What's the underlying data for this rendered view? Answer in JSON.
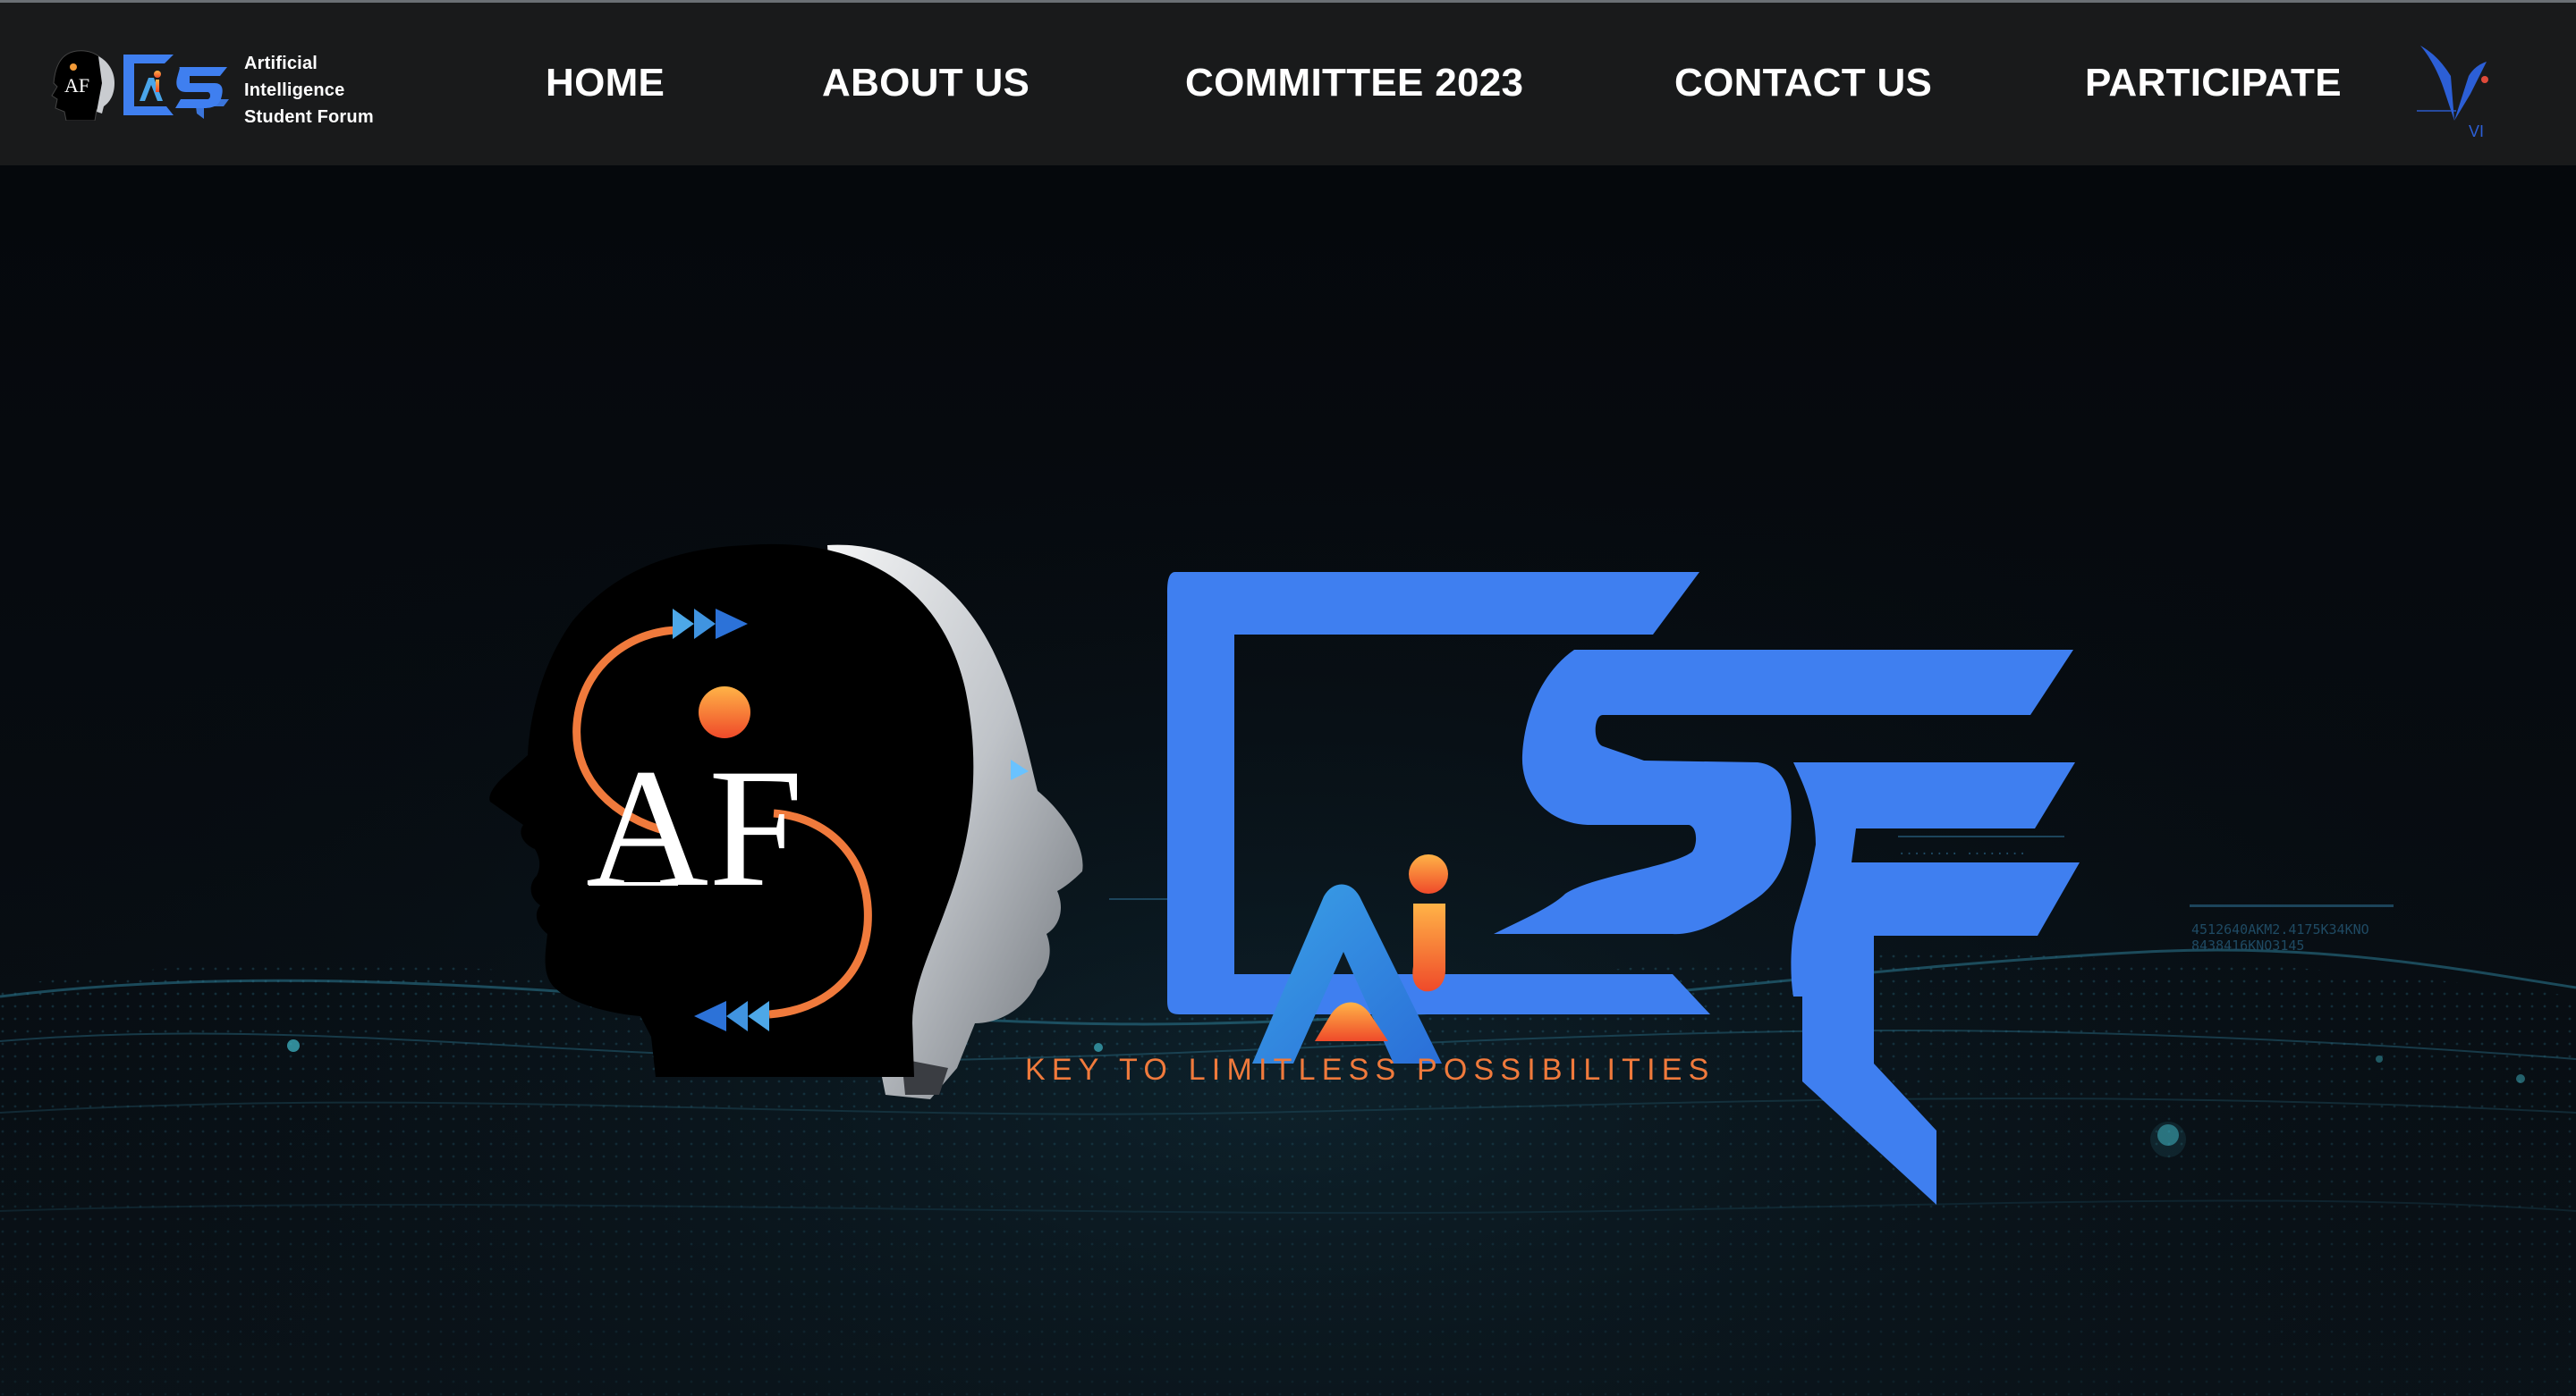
{
  "brand": {
    "line1": "Artificial",
    "line2": "Intelligence",
    "line3": "Student Forum",
    "logo_icon": "aisf-logo-icon"
  },
  "nav": {
    "home": "HOME",
    "about": "ABOUT US",
    "committee": "COMMITTEE 2023",
    "contact": "CONTACT US",
    "participate": "PARTICIPATE"
  },
  "partner_logo": {
    "icon": "vi-logo-icon",
    "label": "VI"
  },
  "hero": {
    "logo_icon": "aisf-hero-logo",
    "head_text": "AF",
    "tagline": "KEY TO LIMITLESS POSSIBILITIES",
    "code_1": "4512640AKM2.4175K34KNO",
    "code_2": "8438416KNO3145"
  },
  "colors": {
    "navbar_bg": "#191a1b",
    "hero_bg": "#06090d",
    "brand_blue": "#3f7ff0",
    "brand_orange": "#f07a3c",
    "nav_text": "#ffffff"
  }
}
